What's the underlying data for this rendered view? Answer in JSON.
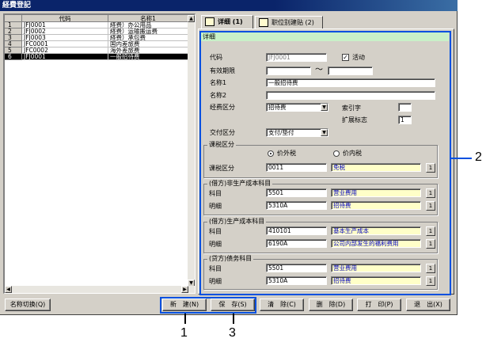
{
  "window": {
    "title": "経費登記"
  },
  "list": {
    "headers": [
      "",
      "代码",
      "名称1"
    ],
    "rows": [
      {
        "num": "1",
        "code": "JFJ0001",
        "name": "経费）办公用品"
      },
      {
        "num": "2",
        "code": "JFJ0002",
        "name": "経费）运输搬运费"
      },
      {
        "num": "3",
        "code": "JFJ0003",
        "name": "経费）承包费"
      },
      {
        "num": "4",
        "code": "JFC0001",
        "name": "国内差旅费"
      },
      {
        "num": "5",
        "code": "JFC0002",
        "name": "海外差旅费"
      },
      {
        "num": "6",
        "code": "JFJ0001",
        "name": "一般招待费"
      }
    ],
    "selected_index": 5
  },
  "tabs": [
    {
      "label": "详细 (1)"
    },
    {
      "label": "职位别建贴 (2)"
    }
  ],
  "detail": {
    "strip": "详细",
    "code_label": "代码",
    "code_value": "JFJ0001",
    "active_label": "活动",
    "period_label": "有效期限",
    "period_sep": "〜",
    "name1_label": "名称1",
    "name1_value": "一般招待费",
    "name2_label": "名称2",
    "expense_type_label": "经费区分",
    "expense_type_value": "招待费",
    "index_label": "索引字",
    "ext_flag_label": "扩展标志",
    "ext_flag_value": "1",
    "payment_label": "交付区分",
    "payment_value": "支付/垫付",
    "tax_group": {
      "title": "课税区分",
      "option1": "价外税",
      "option2": "价内税",
      "field_label": "课税区分",
      "code": "0011",
      "name": "免税"
    },
    "nonprod_group": {
      "title": "(借方)非生产成本科目",
      "account_label": "科目",
      "account_code": "5501",
      "account_name": "营业费用",
      "detail_label": "明细",
      "detail_code": "5310A",
      "detail_name": "招待费"
    },
    "prod_group": {
      "title": "(借方)生产成本科目",
      "account_label": "科目",
      "account_code": "410101",
      "account_name": "基本生产成本",
      "detail_label": "明细",
      "detail_code": "6190A",
      "detail_name": "公司内部发生的福利费用"
    },
    "credit_group": {
      "title": "(贷方)债务科目",
      "account_label": "科目",
      "account_code": "5501",
      "account_name": "营业费用",
      "detail_label": "明细",
      "detail_code": "5310A",
      "detail_name": "招待费"
    },
    "lookup_glyph": "1",
    "dropdown_glyph": "▼"
  },
  "buttons": {
    "name_switch": "名称切换(Q)",
    "new": "新　建(N)",
    "save": "保　存(S)",
    "clear": "清　除(C)",
    "delete": "删　除(D)",
    "print": "打　印(P)",
    "exit": "退　出(X)"
  },
  "callouts": {
    "one": "1",
    "two": "2",
    "three": "3"
  },
  "colors": {
    "callout": "#0050e0",
    "selection": "#000000",
    "strip": "#c8f0c8",
    "lookup_field": "#ffffc8"
  }
}
